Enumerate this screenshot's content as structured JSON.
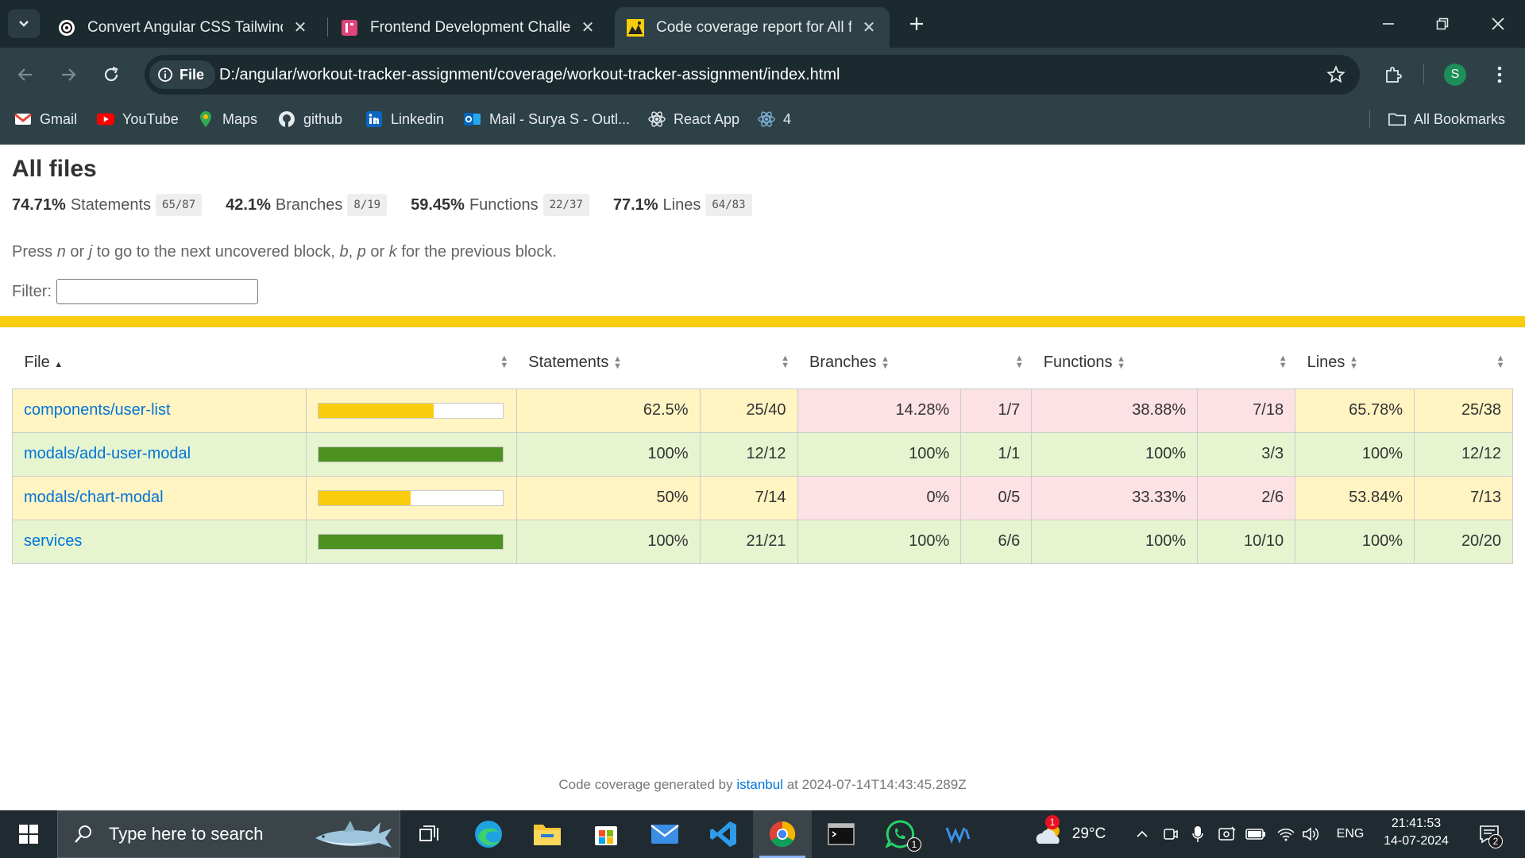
{
  "browser": {
    "tabs": [
      {
        "title": "Convert Angular CSS Tailwind",
        "icon": "openai-icon"
      },
      {
        "title": "Frontend Development Challen",
        "icon": "frontendmentor-icon"
      },
      {
        "title": "Code coverage report for All file",
        "icon": "istanbul-icon"
      }
    ],
    "site_chip": "File",
    "url": "D:/angular/workout-tracker-assignment/coverage/workout-tracker-assignment/index.html",
    "profile_initial": "S",
    "bookmarks": [
      {
        "label": "Gmail",
        "icon": "gmail-icon"
      },
      {
        "label": "YouTube",
        "icon": "youtube-icon"
      },
      {
        "label": "Maps",
        "icon": "maps-icon"
      },
      {
        "label": "github",
        "icon": "github-icon"
      },
      {
        "label": "Linkedin",
        "icon": "linkedin-icon"
      },
      {
        "label": "Mail - Surya S - Outl...",
        "icon": "outlook-icon"
      },
      {
        "label": "React App",
        "icon": "react-icon"
      },
      {
        "label": "4",
        "icon": "react-icon"
      }
    ],
    "all_bookmarks": "All Bookmarks"
  },
  "report": {
    "title": "All files",
    "summary": [
      {
        "pct": "74.71%",
        "label": "Statements",
        "frac": "65/87"
      },
      {
        "pct": "42.1%",
        "label": "Branches",
        "frac": "8/19"
      },
      {
        "pct": "59.45%",
        "label": "Functions",
        "frac": "22/37"
      },
      {
        "pct": "77.1%",
        "label": "Lines",
        "frac": "64/83"
      }
    ],
    "hint": {
      "press": "Press ",
      "n": "n",
      "or1": " or ",
      "j": "j",
      "mid": " to go to the next uncovered block, ",
      "b": "b",
      "comma": ", ",
      "p": "p",
      "or2": " or ",
      "k": "k",
      "end": " for the previous block."
    },
    "filter_label": "Filter:",
    "columns": {
      "file": "File",
      "statements": "Statements",
      "branches": "Branches",
      "functions": "Functions",
      "lines": "Lines"
    },
    "rows": [
      {
        "file": "components/user-list",
        "coverage": 0.625,
        "level": "medium",
        "statements": "62.5%",
        "statements_frac": "25/40",
        "branches": "14.28%",
        "branches_frac": "1/7",
        "functions": "38.88%",
        "functions_frac": "7/18",
        "lines": "65.78%",
        "lines_frac": "25/38"
      },
      {
        "file": "modals/add-user-modal",
        "coverage": 1.0,
        "level": "high",
        "statements": "100%",
        "statements_frac": "12/12",
        "branches": "100%",
        "branches_frac": "1/1",
        "functions": "100%",
        "functions_frac": "3/3",
        "lines": "100%",
        "lines_frac": "12/12"
      },
      {
        "file": "modals/chart-modal",
        "coverage": 0.5,
        "level": "medium",
        "statements": "50%",
        "statements_frac": "7/14",
        "branches": "0%",
        "branches_frac": "0/5",
        "functions": "33.33%",
        "functions_frac": "2/6",
        "lines": "53.84%",
        "lines_frac": "7/13"
      },
      {
        "file": "services",
        "coverage": 1.0,
        "level": "high",
        "statements": "100%",
        "statements_frac": "21/21",
        "branches": "100%",
        "branches_frac": "6/6",
        "functions": "100%",
        "functions_frac": "10/10",
        "lines": "100%",
        "lines_frac": "20/20"
      }
    ],
    "footer": {
      "prefix": "Code coverage generated by ",
      "link": "istanbul",
      "suffix": " at 2024-07-14T14:43:45.289Z"
    }
  },
  "taskbar": {
    "search_placeholder": "Type here to search",
    "weather": "29°C",
    "weather_badge": "1",
    "whatsapp_badge": "1",
    "language": "ENG",
    "time": "21:41:53",
    "date": "14-07-2024",
    "notification_count": "2"
  },
  "colors": {
    "medium": "#f9cd0b",
    "high": "#4d9221",
    "low_bg": "#fce1e5",
    "medium_bg": "#fff4c2",
    "high_bg": "#e6f5d0",
    "link": "#0074d9"
  }
}
